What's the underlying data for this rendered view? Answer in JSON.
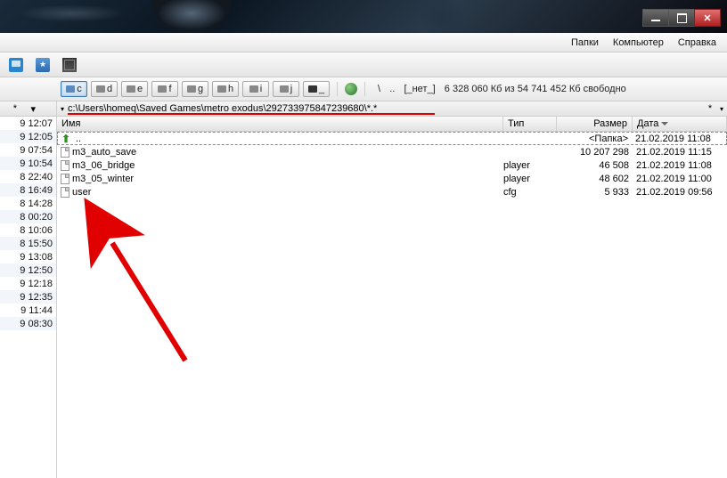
{
  "menu": {
    "folders": "Папки",
    "computer": "Компьютер",
    "help": "Справка"
  },
  "drives": {
    "letters": [
      "c",
      "d",
      "e",
      "f",
      "g",
      "h",
      "i",
      "j"
    ],
    "net_label": "_",
    "info_separator": "\\",
    "info_dots": "..",
    "none_label": "[_нет_]",
    "space_text": "6 328 060 Кб из 54 741 452 Кб свободно"
  },
  "path": {
    "text": "c:\\Users\\homeq\\Saved Games\\metro exodus\\292733975847239680\\*.*",
    "star": "*"
  },
  "left_nav": {
    "star": "*",
    "caret": "▾"
  },
  "left_times": [
    "9 12:07",
    "9 12:05",
    "9 07:54",
    "9 10:54",
    "8 22:40",
    "8 16:49",
    "8 14:28",
    "8 00:20",
    "8 10:06",
    "8 15:50",
    "9 13:08",
    "9 12:50",
    "9 12:18",
    "9 12:35",
    "9 11:44",
    "9 08:30"
  ],
  "columns": {
    "name": "Имя",
    "type": "Тип",
    "size": "Размер",
    "date": "Дата"
  },
  "files": [
    {
      "name": "..",
      "type": "",
      "size": "<Папка>",
      "date": "21.02.2019 11:08",
      "up": true
    },
    {
      "name": "m3_auto_save",
      "type": "",
      "size": "10 207 298",
      "date": "21.02.2019 11:15"
    },
    {
      "name": "m3_06_bridge",
      "type": "player",
      "size": "46 508",
      "date": "21.02.2019 11:08"
    },
    {
      "name": "m3_05_winter",
      "type": "player",
      "size": "48 602",
      "date": "21.02.2019 11:00"
    },
    {
      "name": "user",
      "type": "cfg",
      "size": "5 933",
      "date": "21.02.2019 09:56"
    }
  ]
}
